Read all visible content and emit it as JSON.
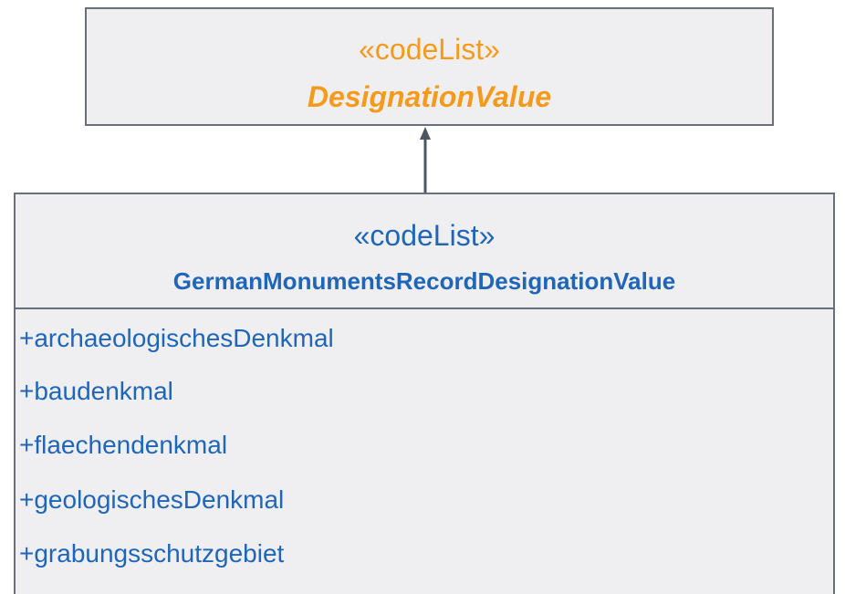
{
  "parent_class": {
    "stereotype": "«codeList»",
    "name": "DesignationValue"
  },
  "child_class": {
    "stereotype": "«codeList»",
    "name": "GermanMonumentsRecordDesignationValue",
    "attributes": [
      "+archaeologischesDenkmal",
      "+baudenkmal",
      "+flaechendenkmal",
      "+geologischesDenkmal",
      "+grabungsschutzgebiet"
    ]
  },
  "colors": {
    "parent_text": "#f59a1b",
    "child_text": "#1f66b8",
    "box_fill": "#efeff1",
    "border": "#6a6f7a"
  }
}
